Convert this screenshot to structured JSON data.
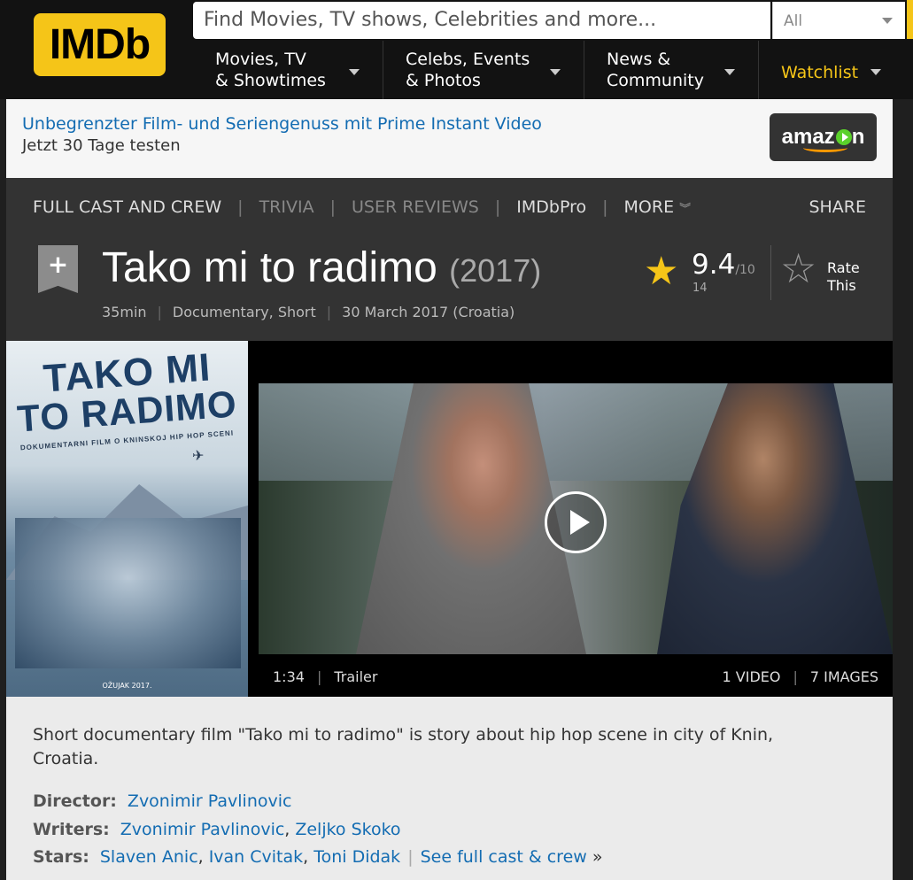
{
  "header": {
    "logo_text": "IMDb",
    "search_placeholder": "Find Movies, TV shows, Celebrities and more...",
    "search_filter": "All",
    "nav": [
      {
        "line1": "Movies, TV",
        "line2": "& Showtimes"
      },
      {
        "line1": "Celebs, Events",
        "line2": "& Photos"
      },
      {
        "line1": "News &",
        "line2": "Community"
      }
    ],
    "watchlist_label": "Watchlist",
    "accent_color": "#f5c518"
  },
  "promo": {
    "headline": "Unbegrenzter Film- und Seriengenuss mit Prime Instant Video",
    "subline": "Jetzt 30 Tage testen",
    "sponsor": "amazon"
  },
  "subnav": {
    "items": [
      "FULL CAST AND CREW",
      "TRIVIA",
      "USER REVIEWS",
      "IMDbPro",
      "MORE"
    ],
    "share_label": "SHARE"
  },
  "title": {
    "name": "Tako mi to radimo",
    "year": "(2017)",
    "runtime": "35min",
    "genres": "Documentary, Short",
    "release": "30 March 2017 (Croatia)",
    "rating_value": "9.4",
    "rating_scale": "/10",
    "rating_count": "14",
    "rate_label_1": "Rate",
    "rate_label_2": "This"
  },
  "poster": {
    "title_line1": "TAKO MI",
    "title_line2": "TO RADIMO",
    "tagline": "DOKUMENTARNI FILM O KNINSKOJ HIP HOP SCENI",
    "date": "OŽUJAK 2017."
  },
  "video": {
    "duration": "1:34",
    "kind": "Trailer",
    "videos_count": "1 VIDEO",
    "images_count": "7 IMAGES"
  },
  "summary": {
    "plot": "Short documentary film \"Tako mi to radimo\" is story about hip hop scene in city of Knin, Croatia.",
    "director_label": "Director:",
    "director": "Zvonimir Pavlinovic",
    "writers_label": "Writers:",
    "writers": [
      "Zvonimir Pavlinovic",
      "Zeljko Skoko"
    ],
    "stars_label": "Stars:",
    "stars": [
      "Slaven Anic",
      "Ivan Cvitak",
      "Toni Didak"
    ],
    "full_cast_link": "See full cast & crew"
  }
}
